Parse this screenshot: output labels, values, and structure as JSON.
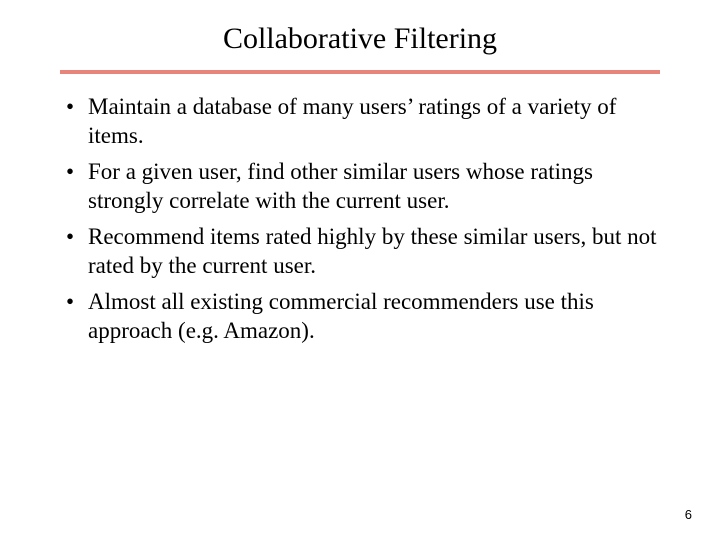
{
  "slide": {
    "title": "Collaborative Filtering",
    "bullets": [
      "Maintain a database of many users’ ratings of a variety of items.",
      "For a given user, find other similar users whose ratings strongly correlate with the current user.",
      "Recommend items rated highly by these similar users, but not rated by the current user.",
      "Almost all existing commercial recommenders use this approach (e.g. Amazon)."
    ],
    "page_number": "6"
  }
}
